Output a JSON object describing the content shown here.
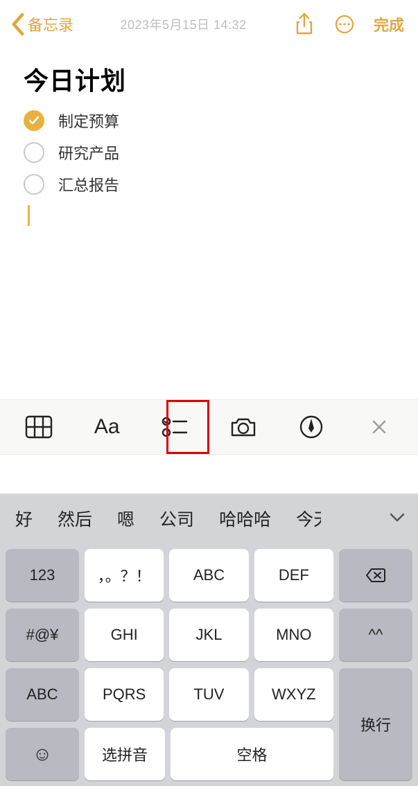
{
  "nav": {
    "back_label": "备忘录",
    "timestamp": "2023年5月15日 14:32",
    "done_label": "完成"
  },
  "note": {
    "title": "今日计划",
    "items": [
      {
        "text": "制定预算",
        "checked": true
      },
      {
        "text": "研究产品",
        "checked": false
      },
      {
        "text": "汇总报告",
        "checked": false
      }
    ]
  },
  "toolbar": {
    "aa_label": "Aa"
  },
  "suggestions": [
    "好",
    "然后",
    "嗯",
    "公司",
    "哈哈哈",
    "今天"
  ],
  "keyboard": {
    "row1": [
      "123",
      "，。？！",
      "ABC",
      "DEF"
    ],
    "row2": [
      "#@¥",
      "GHI",
      "JKL",
      "MNO",
      "^^"
    ],
    "row3": [
      "ABC",
      "PQRS",
      "TUV",
      "WXYZ"
    ],
    "pinyin_label": "选拼音",
    "space_label": "空格",
    "return_label": "换行"
  },
  "colors": {
    "accent": "#e0a73c"
  }
}
